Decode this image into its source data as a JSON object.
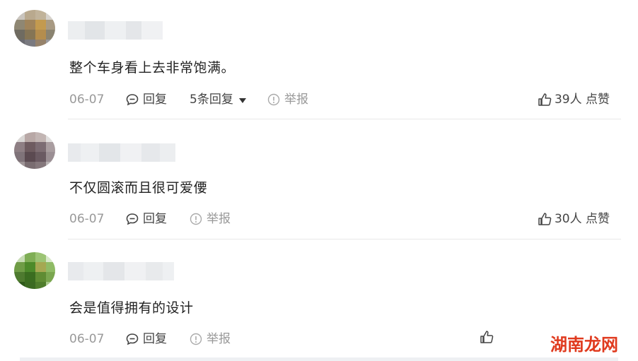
{
  "comments": [
    {
      "text": "整个车身看上去非常饱满。",
      "date": "06-07",
      "reply_label": "回复",
      "replies_label": "5条回复",
      "report_label": "举报",
      "likes": "39人",
      "like_label": "点赞"
    },
    {
      "text": "不仅圆滚而且很可爱偠",
      "date": "06-07",
      "reply_label": "回复",
      "report_label": "举报",
      "likes": "30人",
      "like_label": "点赞"
    },
    {
      "text": "会是值得拥有的设计",
      "date": "06-07",
      "reply_label": "回复",
      "report_label": "举报"
    }
  ],
  "watermark": "湖南龙网",
  "colors": {
    "text": "#222222",
    "meta": "#999999",
    "watermark": "#e03a1e",
    "divider": "#e9e9e9"
  },
  "icons": {
    "reply": "chat-bubble-icon",
    "report": "info-circle-icon",
    "like": "thumbs-up-icon",
    "replies": "caret-down-icon"
  }
}
